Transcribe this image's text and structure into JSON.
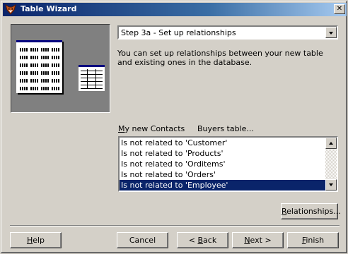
{
  "window": {
    "title": "Table Wizard",
    "close_glyph": "✕",
    "app_icon": "fox-app-icon"
  },
  "step_select": {
    "selected": "Step 3a - Set up relationships"
  },
  "description": "You can set up relationships between your new table and existing ones in the database.",
  "labels": {
    "new_table": "My new Contacts",
    "related_tables": "Buyers table..."
  },
  "relationships_list": {
    "items": [
      "Is not related to 'Customer'",
      "Is not related to 'Products'",
      "Is not related to 'Orditems'",
      "Is not related to 'Orders'",
      "Is not related to 'Employee'"
    ],
    "selected_index": 4
  },
  "buttons": {
    "relationships": "Relationships...",
    "help": "Help",
    "cancel": "Cancel",
    "back": "< Back",
    "next": "Next >",
    "finish": "Finish"
  },
  "colors": {
    "titlebar_start": "#0a246a",
    "titlebar_end": "#a6caf0",
    "selection": "#0a246a",
    "face": "#d4d0c8",
    "preview_bg": "#808080"
  }
}
